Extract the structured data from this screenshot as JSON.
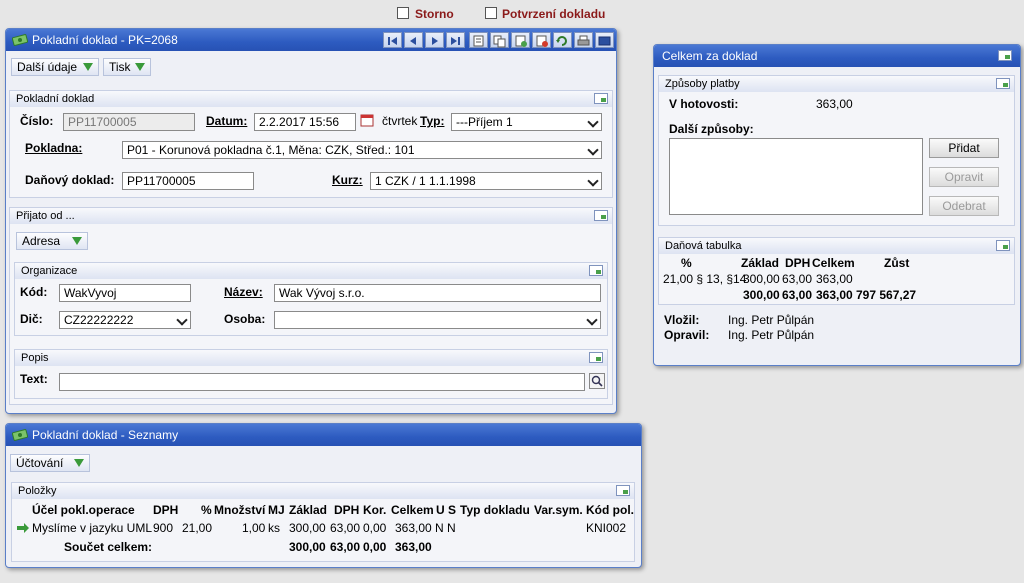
{
  "top": {
    "storno": "Storno",
    "potvrzeni": "Potvrzení dokladu"
  },
  "win1": {
    "title": "Pokladní doklad - PK=2068",
    "toolbar": {
      "dalsi": "Další údaje",
      "tisk": "Tisk"
    },
    "pokladni_doklad": {
      "header": "Pokladní doklad",
      "cislo_label": "Číslo:",
      "cislo_value": "PP11700005",
      "datum_label": "Datum:",
      "datum_value": "2.2.2017 15:56",
      "den": "čtvrtek",
      "typ_label": "Typ:",
      "typ_value": "---Příjem 1",
      "pokladna_label": "Pokladna:",
      "pokladna_value": "P01 - Korunová pokladna č.1, Měna: CZK, Střed.: 101",
      "danovy_label": "Daňový doklad:",
      "danovy_value": "PP11700005",
      "kurz_label": "Kurz:",
      "kurz_value": "1 CZK / 1 1.1.1998"
    },
    "prijato": {
      "header": "Přijato od ...",
      "adresa": "Adresa",
      "organizace": "Organizace",
      "kod_label": "Kód:",
      "kod_value": "WakVyvoj",
      "nazev_label": "Název:",
      "nazev_value": "Wak Vývoj s.r.o.",
      "dic_label": "Dič:",
      "dic_value": "CZ22222222",
      "osoba_label": "Osoba:",
      "osoba_value": "",
      "popis": "Popis",
      "text_label": "Text:",
      "text_value": ""
    }
  },
  "win2": {
    "title": "Pokladní doklad - Seznamy",
    "toolbar": {
      "uctovani": "Účtování"
    },
    "polozky": {
      "header": "Položky",
      "columns": [
        "Účel pokl.operace",
        "DPH",
        "%",
        "Množství",
        "MJ",
        "Základ",
        "DPH",
        "Kor.",
        "Celkem",
        "U",
        "S",
        "Typ dokladu",
        "Var.sym.",
        "Kód pol."
      ],
      "row": [
        "Myslíme v jazyku UML",
        "900",
        "21,00",
        "1,00",
        "ks",
        "300,00",
        "63,00",
        "0,00",
        "363,00",
        "N",
        "N",
        "",
        "",
        "KNI002"
      ],
      "sum_label": "Součet celkem:",
      "sum": [
        "300,00",
        "63,00",
        "0,00",
        "363,00"
      ]
    }
  },
  "win3": {
    "title": "Celkem za doklad",
    "zpusoby": {
      "header": "Způsoby platby",
      "hotovost_label": "V hotovosti:",
      "hotovost_value": "363,00",
      "dalsi_label": "Další způsoby:",
      "pridat": "Přidat",
      "opravit": "Opravit",
      "odebrat": "Odebrat"
    },
    "danova": {
      "header": "Daňová tabulka",
      "columns": [
        "%",
        "Základ",
        "DPH",
        "Celkem",
        "Zůst"
      ],
      "row": [
        "21,00 § 13, §14",
        "300,00",
        "63,00",
        "363,00",
        ""
      ],
      "total": [
        "",
        "300,00",
        "63,00",
        "363,00",
        "797 567,27"
      ]
    },
    "vlozil_label": "Vložil:",
    "vlozil_value": "Ing. Petr Půlpán",
    "opravil_label": "Opravil:",
    "opravil_value": "Ing. Petr Půlpán"
  }
}
